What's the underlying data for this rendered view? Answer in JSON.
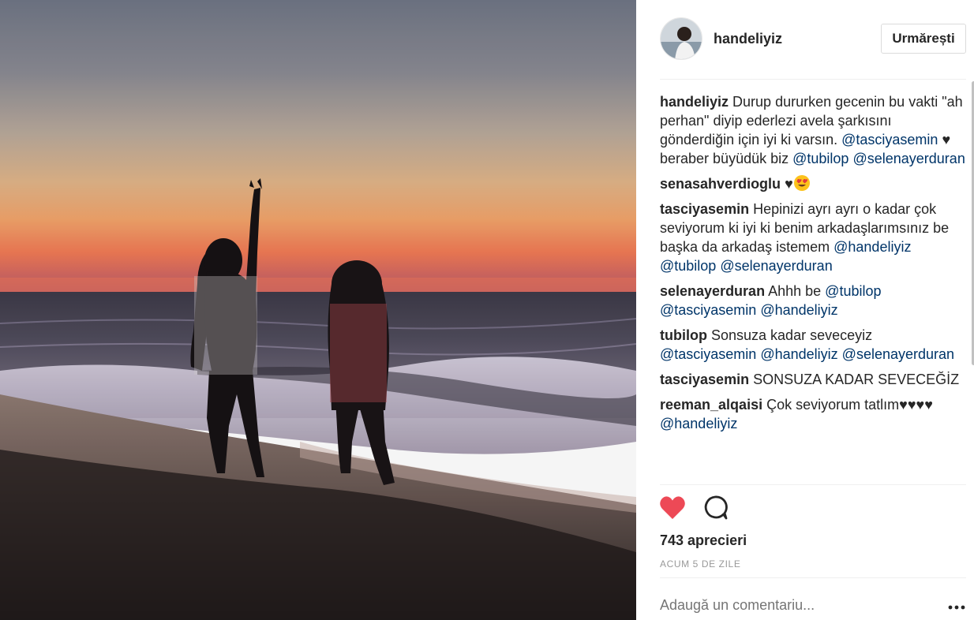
{
  "post": {
    "username": "handeliyiz",
    "follow_label": "Urmărești",
    "likes_text": "743 aprecieri",
    "timestamp": "ACUM 5 DE ZILE",
    "add_comment_placeholder": "Adaugă un comentariu...",
    "comments": [
      {
        "user": "handeliyiz",
        "text": "Durup dururken gecenin bu vakti \"ah perhan\" diyip ederlezi avela şarkısını gönderdiğin için iyi ki varsın.",
        "mention1": "@tasciyasemin",
        "text2": "♥ beraber büyüdük biz",
        "mention2": "@tubilop",
        "mention3": "@selenayerduran"
      },
      {
        "user": "senasahverdioglu",
        "text": "♥"
      },
      {
        "user": "tasciyasemin",
        "text": "Hepinizi ayrı ayrı o kadar çok seviyorum ki iyi ki benim arkadaşlarımsınız be başka da arkadaş istemem",
        "mention1": "@handeliyiz",
        "mention2": "@tubilop",
        "mention3": "@selenayerduran"
      },
      {
        "user": "selenayerduran",
        "text": "Ahhh be",
        "mention1": "@tubilop",
        "mention2": "@tasciyasemin",
        "mention3": "@handeliyiz"
      },
      {
        "user": "tubilop",
        "text": "Sonsuza kadar seveceyiz",
        "mention1": "@tasciyasemin",
        "mention2": "@handeliyiz",
        "mention3": "@selenayerduran"
      },
      {
        "user": "tasciyasemin",
        "text": "SONSUZA KADAR SEVECEĞİZ"
      },
      {
        "user": "reeman_alqaisi",
        "text": "Çok seviyorum tatlım♥♥♥♥",
        "mention1": "@handeliyiz"
      }
    ]
  },
  "colors": {
    "heart": "#ed4956",
    "mention": "#003569",
    "muted": "#999999"
  },
  "icons": {
    "like": "heart-icon",
    "comment": "speech-bubble-icon",
    "more": "more-dots-icon"
  }
}
